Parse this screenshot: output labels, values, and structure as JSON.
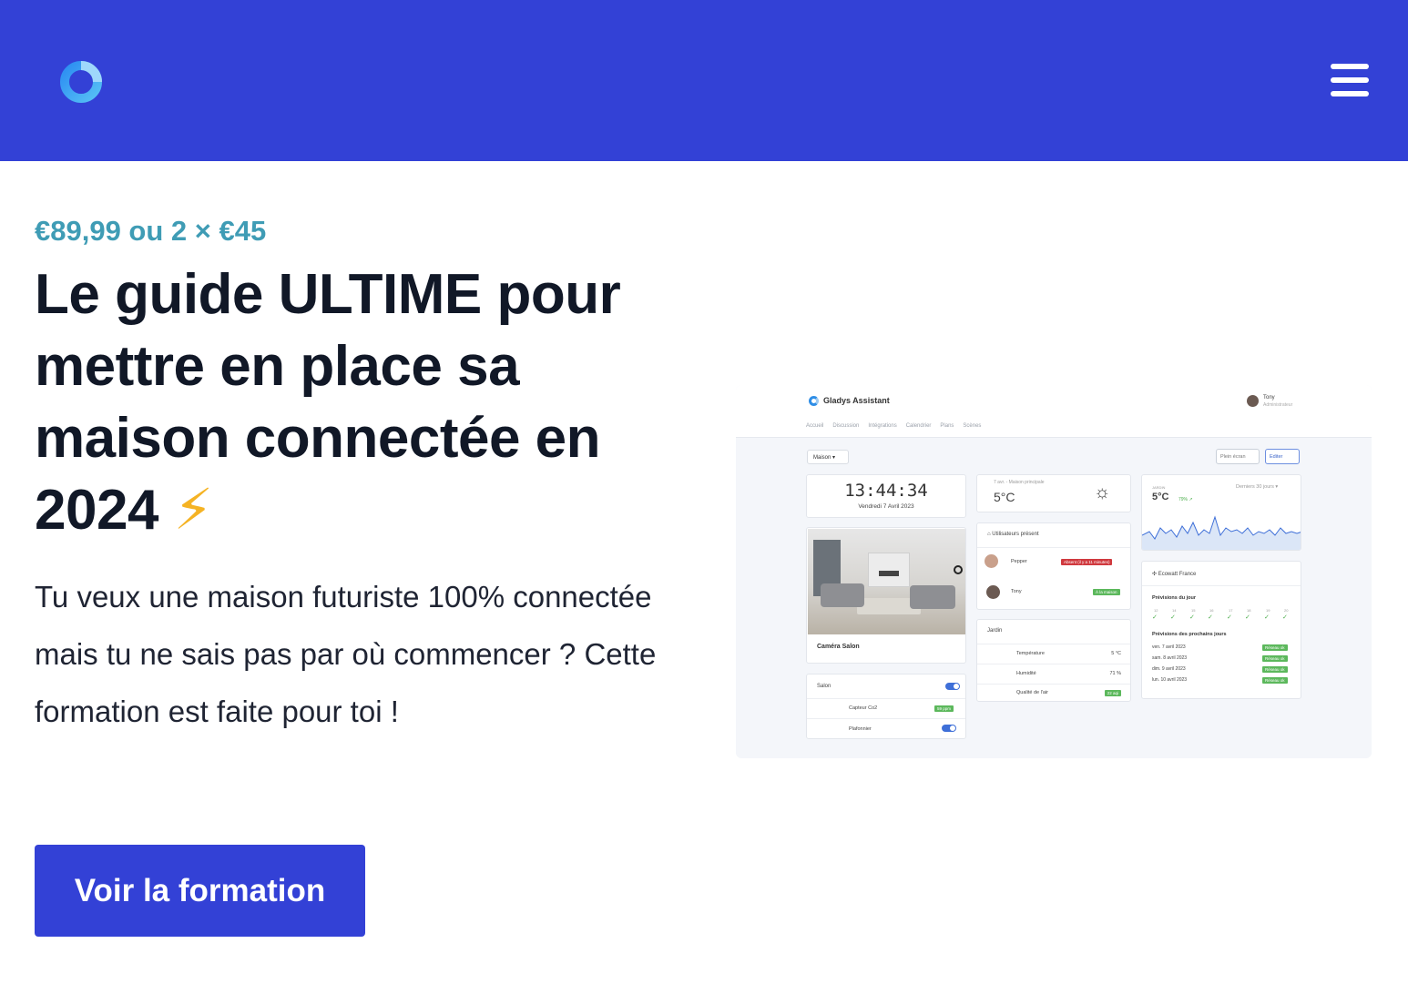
{
  "header": {
    "logo_icon": "gladys-logo-icon",
    "menu_icon": "hamburger-menu-icon",
    "background": "#3341d6"
  },
  "hero": {
    "price": "€89,99 ou 2 × €45",
    "headline": "Le guide ULTIME pour mettre en place sa maison connectée en 2024",
    "headline_emoji": "⚡",
    "description": "Tu veux une maison futuriste 100% connectée mais tu ne sais pas par où commencer ? Cette formation est faite pour toi !",
    "cta_label": "Voir la formation",
    "accent_price": "#3f9cb5",
    "accent_button": "#3341d6"
  },
  "dashboard": {
    "brand": "Gladys Assistant",
    "user_name": "Tony",
    "user_role": "Administrateur",
    "nav": [
      "Accueil",
      "Discussion",
      "Intégrations",
      "Calendrier",
      "Plans",
      "Scènes"
    ],
    "house_select": "Maison",
    "fullscreen_label": "Plein écran",
    "edit_label": "Editer",
    "clock_time": "13:44:34",
    "clock_date": "Vendredi 7 Avril 2023",
    "camera_label": "Caméra Salon",
    "salon_title": "Salon",
    "salon_rows": [
      {
        "label": "Capteur Co2",
        "value": "59 ppm"
      },
      {
        "label": "Plafonnier",
        "value": ""
      }
    ],
    "weather_caption": "7 avr. - Maison principale",
    "weather_temp": "5°C",
    "users_title": "Utilisateurs présent",
    "users": [
      {
        "name": "Pepper",
        "status": "Absent (il y a 11 minutes)"
      },
      {
        "name": "Tony",
        "status": "À la maison"
      }
    ],
    "jardin_title": "Jardin",
    "jardin_rows": [
      {
        "label": "Température",
        "value": "5 °C"
      },
      {
        "label": "Humidité",
        "value": "71 %"
      },
      {
        "label": "Qualité de l'air",
        "value": "22 aqi"
      }
    ],
    "chart_caption": "JARDIN",
    "chart_period": "Derniers 30 jours",
    "chart_temp": "5°C",
    "chart_delta": "79% ↗",
    "ecowatt_title": "Ecowatt France",
    "forecast_day_title": "Prévisions du jour",
    "forecast_hours": [
      "12",
      "14",
      "15",
      "16",
      "17",
      "18",
      "19",
      "20"
    ],
    "forecast_next_title": "Prévisions des prochains jours",
    "forecast_days": [
      {
        "day": "ven. 7 avril 2023",
        "status": "Réseau ok"
      },
      {
        "day": "sam. 8 avril 2023",
        "status": "Réseau ok"
      },
      {
        "day": "dim. 9 avril 2023",
        "status": "Réseau ok"
      },
      {
        "day": "lun. 10 avril 2023",
        "status": "Réseau ok"
      }
    ]
  }
}
